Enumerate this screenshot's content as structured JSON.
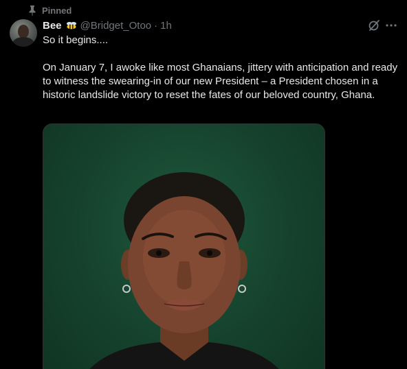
{
  "post": {
    "pinned_label": "Pinned",
    "author": {
      "display_name": "Bee",
      "handle": "@Bridget_Otoo",
      "separator": "·",
      "time": "1h"
    },
    "text": "So it begins....\n\nOn January 7, I awoke like most Ghanaians, jittery with anticipation and ready to witness the swearing-in of our new President – a President chosen in a historic landslide victory to reset the fates of our beloved country, Ghana.",
    "icons": {
      "pin": "pin-icon",
      "bee": "bee-emoji-icon",
      "grok": "grok-icon",
      "more": "more-options-icon"
    },
    "colors": {
      "background": "#000000",
      "text_primary": "#e7e9ea",
      "text_secondary": "#71767b",
      "media_background": "#17452f"
    }
  }
}
